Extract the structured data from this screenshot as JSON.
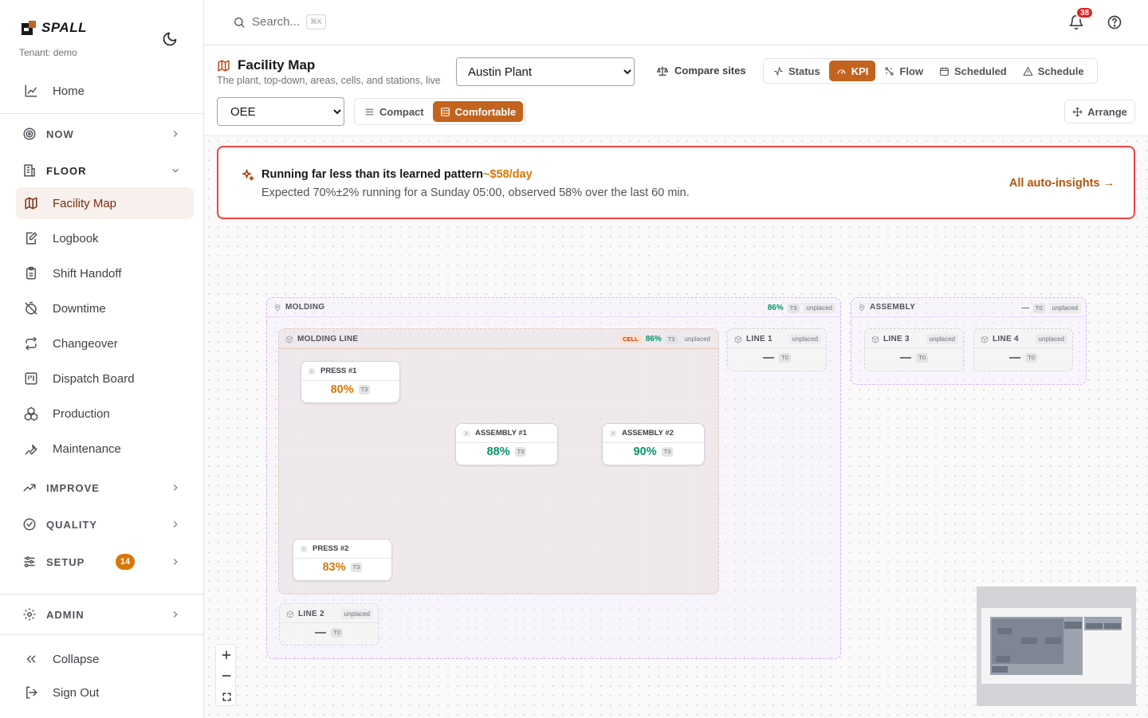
{
  "app": {
    "name": "SPALL",
    "tenant": "Tenant: demo"
  },
  "sidebar": {
    "home": "Home",
    "groups": {
      "now": "NOW",
      "floor": "FLOOR",
      "improve": "IMPROVE",
      "quality": "QUALITY",
      "setup": "SETUP",
      "admin": "ADMIN"
    },
    "setup_badge": "14",
    "floor_items": [
      {
        "label": "Facility Map",
        "icon": "map-icon"
      },
      {
        "label": "Logbook",
        "icon": "edit-note-icon"
      },
      {
        "label": "Shift Handoff",
        "icon": "clipboard-icon"
      },
      {
        "label": "Downtime",
        "icon": "timer-off-icon"
      },
      {
        "label": "Changeover",
        "icon": "repeat-icon"
      },
      {
        "label": "Dispatch Board",
        "icon": "kanban-icon"
      },
      {
        "label": "Production",
        "icon": "boxes-icon"
      },
      {
        "label": "Maintenance",
        "icon": "wrench-icon"
      }
    ],
    "collapse": "Collapse",
    "signout": "Sign Out"
  },
  "topbar": {
    "search_placeholder": "Search...",
    "search_shortcut": "⌘K",
    "notification_count": "38"
  },
  "header": {
    "title": "Facility Map",
    "subtitle": "The plant, top-down, areas, cells, and stations, live",
    "site": "Austin Plant",
    "compare": "Compare sites",
    "views": [
      "Status",
      "KPI",
      "Flow",
      "Scheduled",
      "Schedule"
    ],
    "active_view": "KPI",
    "kpi": "OEE",
    "density": [
      "Compact",
      "Comfortable"
    ],
    "active_density": "Comfortable",
    "arrange": "Arrange"
  },
  "insight": {
    "title": "Running far less than its learned pattern",
    "cost": "~$58/day",
    "body": "Expected 70%±2% running for a Sunday 05:00, observed 58% over the last 60 min.",
    "link": "All auto-insights →"
  },
  "map": {
    "molding": {
      "name": "MOLDING",
      "pct": "86%",
      "tier": "T3",
      "status": "unplaced"
    },
    "molding_line": {
      "name": "MOLDING LINE",
      "tag": "CELL",
      "pct": "86%",
      "tier": "T3",
      "status": "unplaced"
    },
    "stations": [
      {
        "name": "PRESS #1",
        "pct": "80%",
        "tier": "T3"
      },
      {
        "name": "ASSEMBLY #1",
        "pct": "88%",
        "tier": "T3"
      },
      {
        "name": "ASSEMBLY #2",
        "pct": "90%",
        "tier": "T3"
      },
      {
        "name": "PRESS #2",
        "pct": "83%",
        "tier": "T3"
      }
    ],
    "line1": {
      "name": "LINE 1",
      "status": "unplaced",
      "tier": "T0"
    },
    "line2": {
      "name": "LINE 2",
      "status": "unplaced",
      "tier": "T0"
    },
    "assembly": {
      "name": "ASSEMBLY",
      "tier": "T0",
      "status": "unplaced"
    },
    "line3": {
      "name": "LINE 3",
      "status": "unplaced",
      "tier": "T0"
    },
    "line4": {
      "name": "LINE 4",
      "status": "unplaced",
      "tier": "T0"
    }
  },
  "colors": {
    "accent": "#c2631e",
    "alert": "#ef4444",
    "good": "#059669",
    "warn": "#d97706"
  }
}
